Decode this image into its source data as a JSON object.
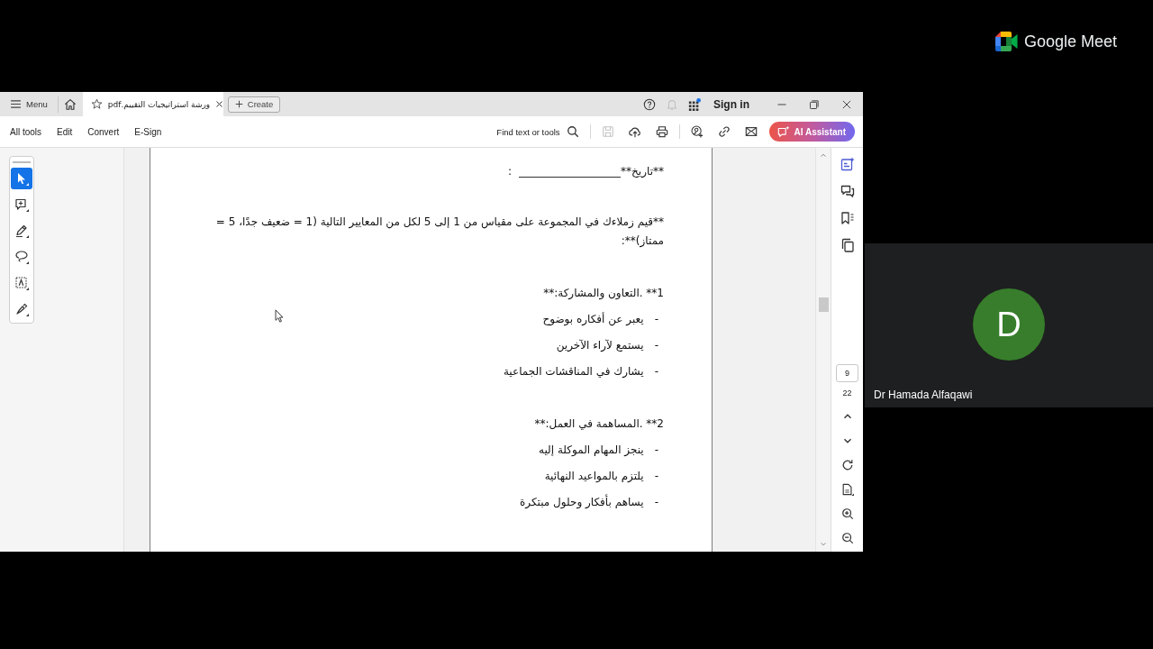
{
  "app_window": {
    "menu_label": "Menu",
    "tab": {
      "title": "ورشة استراتيجيات التقييم.pdf",
      "selected": true
    },
    "create_label": "Create",
    "notifications": {
      "disabled": true
    },
    "sign_in": "Sign in"
  },
  "toolbar": {
    "all_tools": "All tools",
    "edit": "Edit",
    "convert": "Convert",
    "e_sign": "E-Sign",
    "search_label": "Find text or tools",
    "save": {
      "disabled": true
    },
    "ai_assistant": "AI Assistant"
  },
  "tool_rail": [
    {
      "kind": "select",
      "selected": true
    },
    {
      "kind": "comment",
      "selected": false
    },
    {
      "kind": "draw",
      "selected": false
    },
    {
      "kind": "lasso",
      "selected": false
    },
    {
      "kind": "text-box",
      "selected": false
    },
    {
      "kind": "sign",
      "selected": false
    }
  ],
  "document": {
    "date_line": {
      "label": "**تاريخ**",
      "suffix": ":"
    },
    "instruction": "**قيم زملاءك في المجموعة على مقياس من 1 إلى 5 لكل من المعايير التالية (1 = ضعيف جدًا، 5 = ممتاز)**:",
    "sections": [
      {
        "heading": "1** .التعاون والمشاركة:**",
        "items": [
          {
            "bullet": "-",
            "text": "يعبر عن أفكاره بوضوح"
          },
          {
            "bullet": "-",
            "text": "يستمع لآراء الآخرين"
          },
          {
            "bullet": "-",
            "text": "يشارك في المناقشات الجماعية"
          }
        ]
      },
      {
        "heading": "2** .المساهمة في العمل:**",
        "items": [
          {
            "bullet": "-",
            "text": "ينجز المهام الموكلة إليه"
          },
          {
            "bullet": "-",
            "text": "يلتزم بالمواعيد النهائية"
          },
          {
            "bullet": "-",
            "text": "يساهم بأفكار وحلول مبتكرة"
          }
        ]
      }
    ]
  },
  "page_nav": {
    "page_number": "9",
    "page_count": "22"
  },
  "meet": {
    "logo_text": "Google Meet",
    "participant": {
      "initial": "D",
      "name": "Dr Hamada Alfaqawi"
    }
  }
}
